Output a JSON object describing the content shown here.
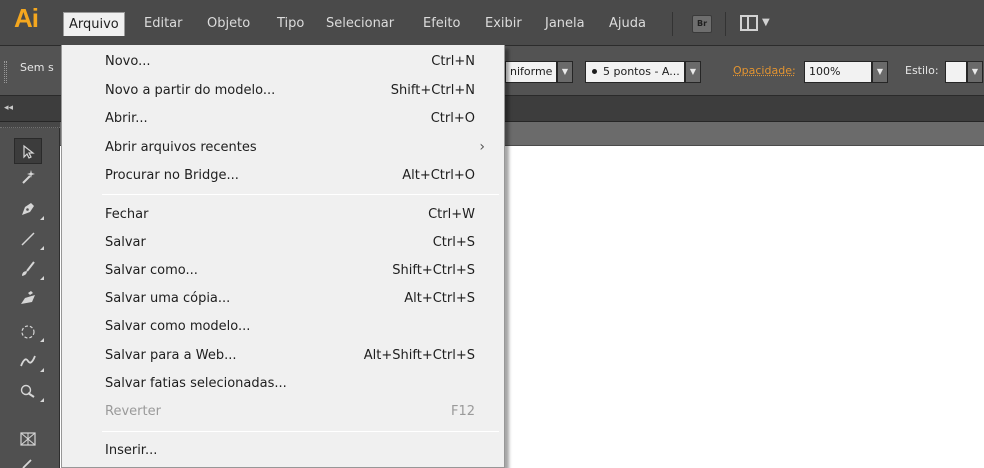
{
  "menubar": {
    "logo": "Ai",
    "items": [
      {
        "label": "Arquivo"
      },
      {
        "label": "Editar"
      },
      {
        "label": "Objeto"
      },
      {
        "label": "Tipo"
      },
      {
        "label": "Selecionar"
      },
      {
        "label": "Efeito"
      },
      {
        "label": "Exibir"
      },
      {
        "label": "Janela"
      },
      {
        "label": "Ajuda"
      }
    ],
    "bridge_label": "Br"
  },
  "controlbar": {
    "selection_label": "Sem s",
    "stroke_profile": "niforme",
    "brush": "5 pontos - A...",
    "opacity_label": "Opacidade:",
    "opacity_value": "100%",
    "style_label": "Estilo:"
  },
  "panelbar": {
    "collapse": "◂◂"
  },
  "file_menu": {
    "items": [
      {
        "label": "Novo...",
        "shortcut": "Ctrl+N"
      },
      {
        "label": "Novo a partir do modelo...",
        "shortcut": "Shift+Ctrl+N"
      },
      {
        "label": "Abrir...",
        "shortcut": "Ctrl+O"
      },
      {
        "label": "Abrir arquivos recentes",
        "shortcut": "",
        "submenu_arrow": "›"
      },
      {
        "label": "Procurar no Bridge...",
        "shortcut": "Alt+Ctrl+O"
      },
      {
        "label": "Fechar",
        "shortcut": "Ctrl+W"
      },
      {
        "label": "Salvar",
        "shortcut": "Ctrl+S"
      },
      {
        "label": "Salvar como...",
        "shortcut": "Shift+Ctrl+S"
      },
      {
        "label": "Salvar uma cópia...",
        "shortcut": "Alt+Ctrl+S"
      },
      {
        "label": "Salvar como modelo...",
        "shortcut": ""
      },
      {
        "label": "Salvar para a Web...",
        "shortcut": "Alt+Shift+Ctrl+S"
      },
      {
        "label": "Salvar fatias selecionadas...",
        "shortcut": ""
      },
      {
        "label": "Reverter",
        "shortcut": "F12",
        "disabled": true
      },
      {
        "label": "Inserir...",
        "shortcut": ""
      }
    ]
  },
  "colors": {
    "accent_logo": "#f4a71f",
    "opacity_link": "#e39431",
    "menubar_bg": "#4a4a4a",
    "menu_bg": "#f0f0f0"
  }
}
